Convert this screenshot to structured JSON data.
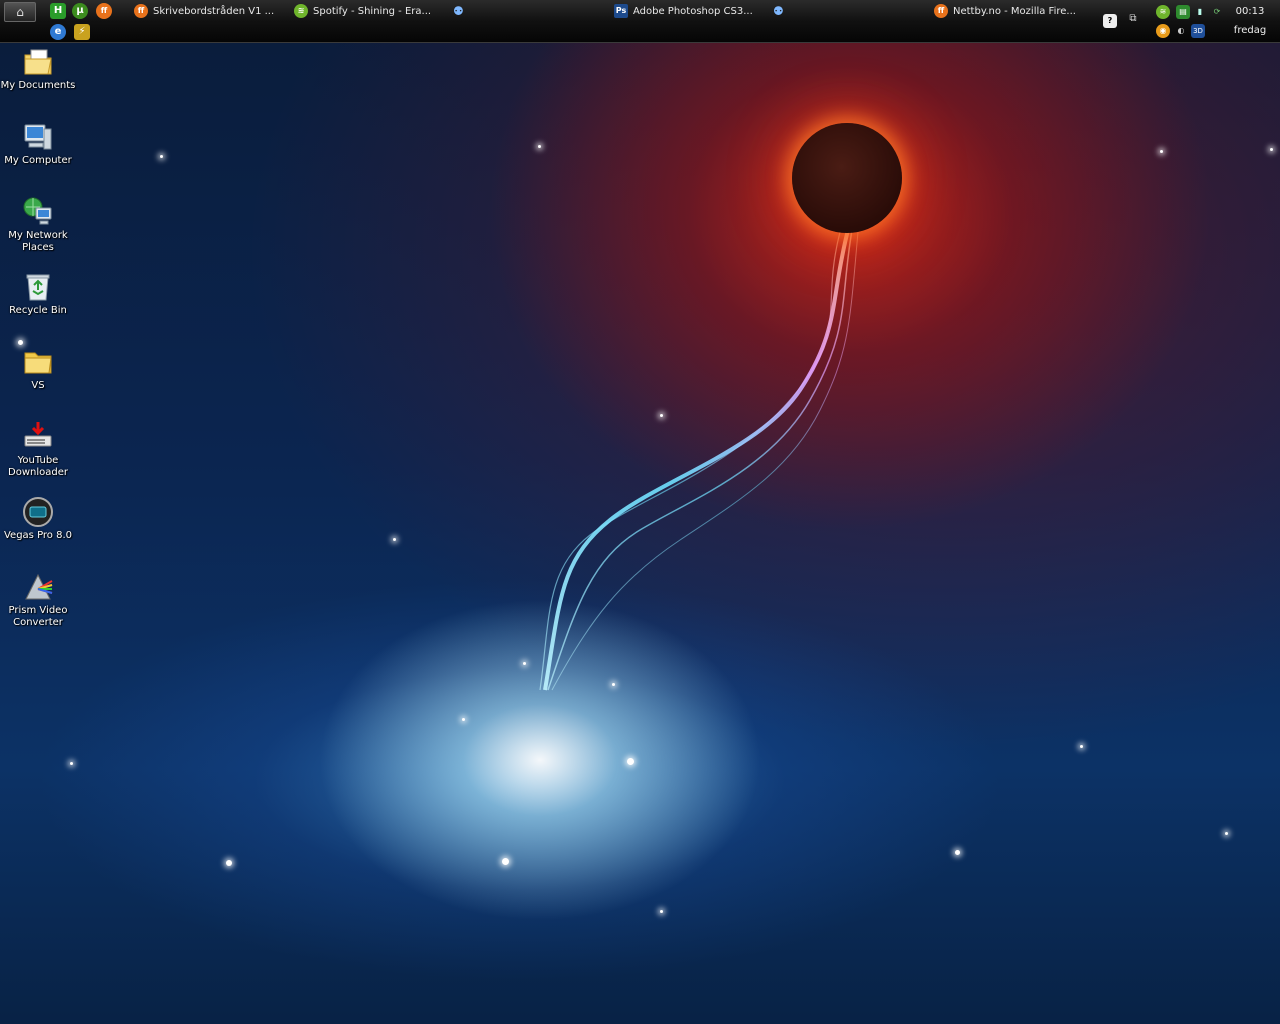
{
  "taskbar": {
    "start_icon": "home-icon",
    "quicklaunch": [
      {
        "name": "quicklaunch-green-app",
        "glyph": "H",
        "color": "#2a9d2a"
      },
      {
        "name": "quicklaunch-utorrent",
        "glyph": "µ",
        "color": "#3c8c1e"
      },
      {
        "name": "quicklaunch-firefox",
        "glyph": "ff",
        "color": "#e8721c"
      },
      {
        "name": "quicklaunch-ie",
        "glyph": "e",
        "color": "#2f79d2"
      },
      {
        "name": "quicklaunch-winamp",
        "glyph": "⚡",
        "color": "#c9a21f"
      }
    ],
    "tasks": [
      {
        "label": "Skrivebordstråden V1 ...",
        "icon": "firefox-icon",
        "color": "#e8721c",
        "glyph": "ff"
      },
      {
        "label": "Spotify - Shining - Era...",
        "icon": "spotify-icon",
        "color": "#6fb52c",
        "glyph": "≋"
      },
      {
        "label": "Adobe Photoshop CS3...",
        "icon": "photoshop-icon",
        "color": "#1d4a8c",
        "glyph": "Ps"
      },
      {
        "label": "Nettby.no - Mozilla Fire...",
        "icon": "firefox-icon",
        "color": "#e8721c",
        "glyph": "ff"
      }
    ],
    "clock": "00:13",
    "day": "fredag"
  },
  "desktop_icons": [
    {
      "label": "My Documents",
      "icon": "my-documents-icon"
    },
    {
      "label": "My Computer",
      "icon": "my-computer-icon"
    },
    {
      "label": "My Network Places",
      "icon": "network-places-icon"
    },
    {
      "label": "Recycle Bin",
      "icon": "recycle-bin-icon"
    },
    {
      "label": "VS",
      "icon": "folder-icon"
    },
    {
      "label": "YouTube Downloader",
      "icon": "youtube-downloader-icon"
    },
    {
      "label": "Vegas Pro 8.0",
      "icon": "vegas-pro-icon"
    },
    {
      "label": "Prism Video Converter",
      "icon": "prism-converter-icon"
    }
  ]
}
